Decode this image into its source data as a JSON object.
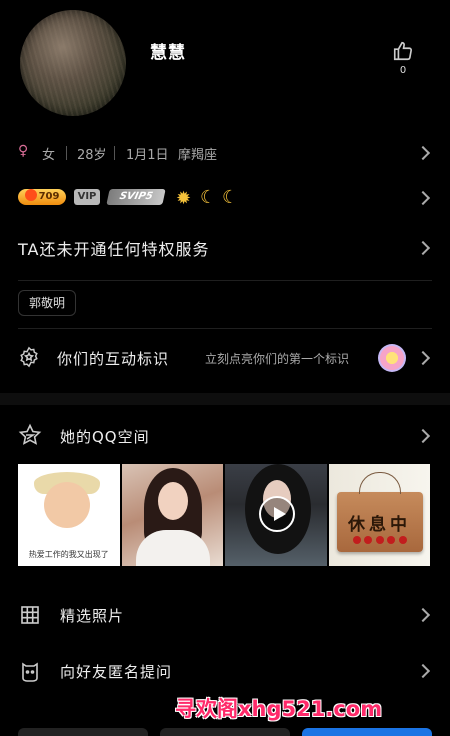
{
  "profile": {
    "nickname": "慧慧",
    "likes": "0",
    "gender_symbol": "♀",
    "gender": "女",
    "age": "28岁",
    "birthday": "1月1日",
    "zodiac": "摩羯座"
  },
  "badges": {
    "level": "709",
    "vip": "VIP",
    "svip": "SVIP5"
  },
  "privilege": {
    "label": "TA还未开通任何特权服务"
  },
  "tags": [
    "郭敬明"
  ],
  "interaction": {
    "label": "你们的互动标识",
    "hint": "立刻点亮你们的第一个标识"
  },
  "qzone": {
    "label": "她的QQ空间",
    "photos": [
      {
        "caption": "热爱工作的我又出现了"
      },
      {
        "caption": ""
      },
      {
        "caption": ""
      },
      {
        "caption": "休息中"
      }
    ]
  },
  "menu": {
    "photos": "精选照片",
    "ask": "向好友匿名提问"
  },
  "watermark": "寻欢阁xhg521.com",
  "colors": {
    "background": "#000000",
    "gender": "#d86d96",
    "accent": "#1b74e4",
    "watermark": "#ff2a6a"
  }
}
